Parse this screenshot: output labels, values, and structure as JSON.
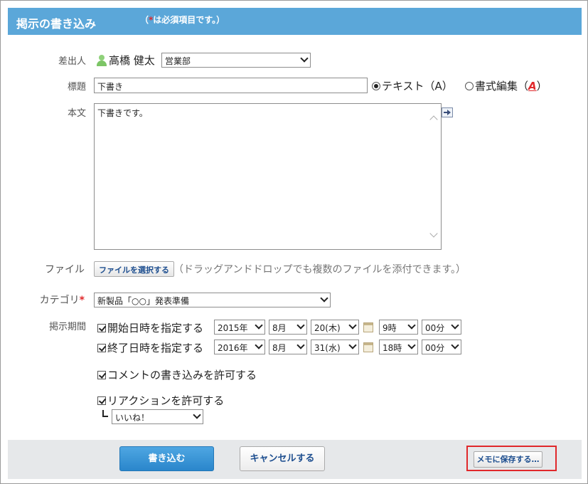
{
  "header": {
    "title": "掲示の書き込み",
    "note_open": "（",
    "note_star": "*",
    "note_rest": "は必須項目です。）"
  },
  "form": {
    "sender": {
      "label": "差出人",
      "name": "高橋 健太",
      "department": "営業部"
    },
    "subject": {
      "label": "標題",
      "value": "下書き",
      "radio_text": "テキスト（A）",
      "radio_rich_prefix": "書式編集（",
      "radio_rich_icon": "A",
      "radio_rich_suffix": "）"
    },
    "body": {
      "label": "本文",
      "value": "下書きです。"
    },
    "file": {
      "label": "ファイル",
      "button": "ファイルを選択する",
      "hint": "（ドラッグアンドドロップでも複数のファイルを添付できます。）"
    },
    "category": {
      "label": "カテゴリ",
      "required_mark": "*",
      "value": "新製品「○○」発表準備"
    },
    "period": {
      "label": "掲示期間",
      "start": {
        "label": "開始日時を指定する",
        "year": "2015年",
        "month": "8月",
        "day": "20(木)",
        "hour": "9時",
        "minute": "00分"
      },
      "end": {
        "label": "終了日時を指定する",
        "year": "2016年",
        "month": "8月",
        "day": "31(水)",
        "hour": "18時",
        "minute": "00分"
      }
    },
    "allow_comments": "コメントの書き込みを許可する",
    "allow_reactions": "リアクションを許可する",
    "reaction_type": "いいね！"
  },
  "footer": {
    "submit": "書き込む",
    "cancel": "キャンセルする",
    "save_memo": "メモに保存する…"
  },
  "colors": {
    "header_bg": "#5ba7d9",
    "primary_button": "#2a86cb",
    "required": "#e0282b",
    "highlight": "#e0282b"
  }
}
